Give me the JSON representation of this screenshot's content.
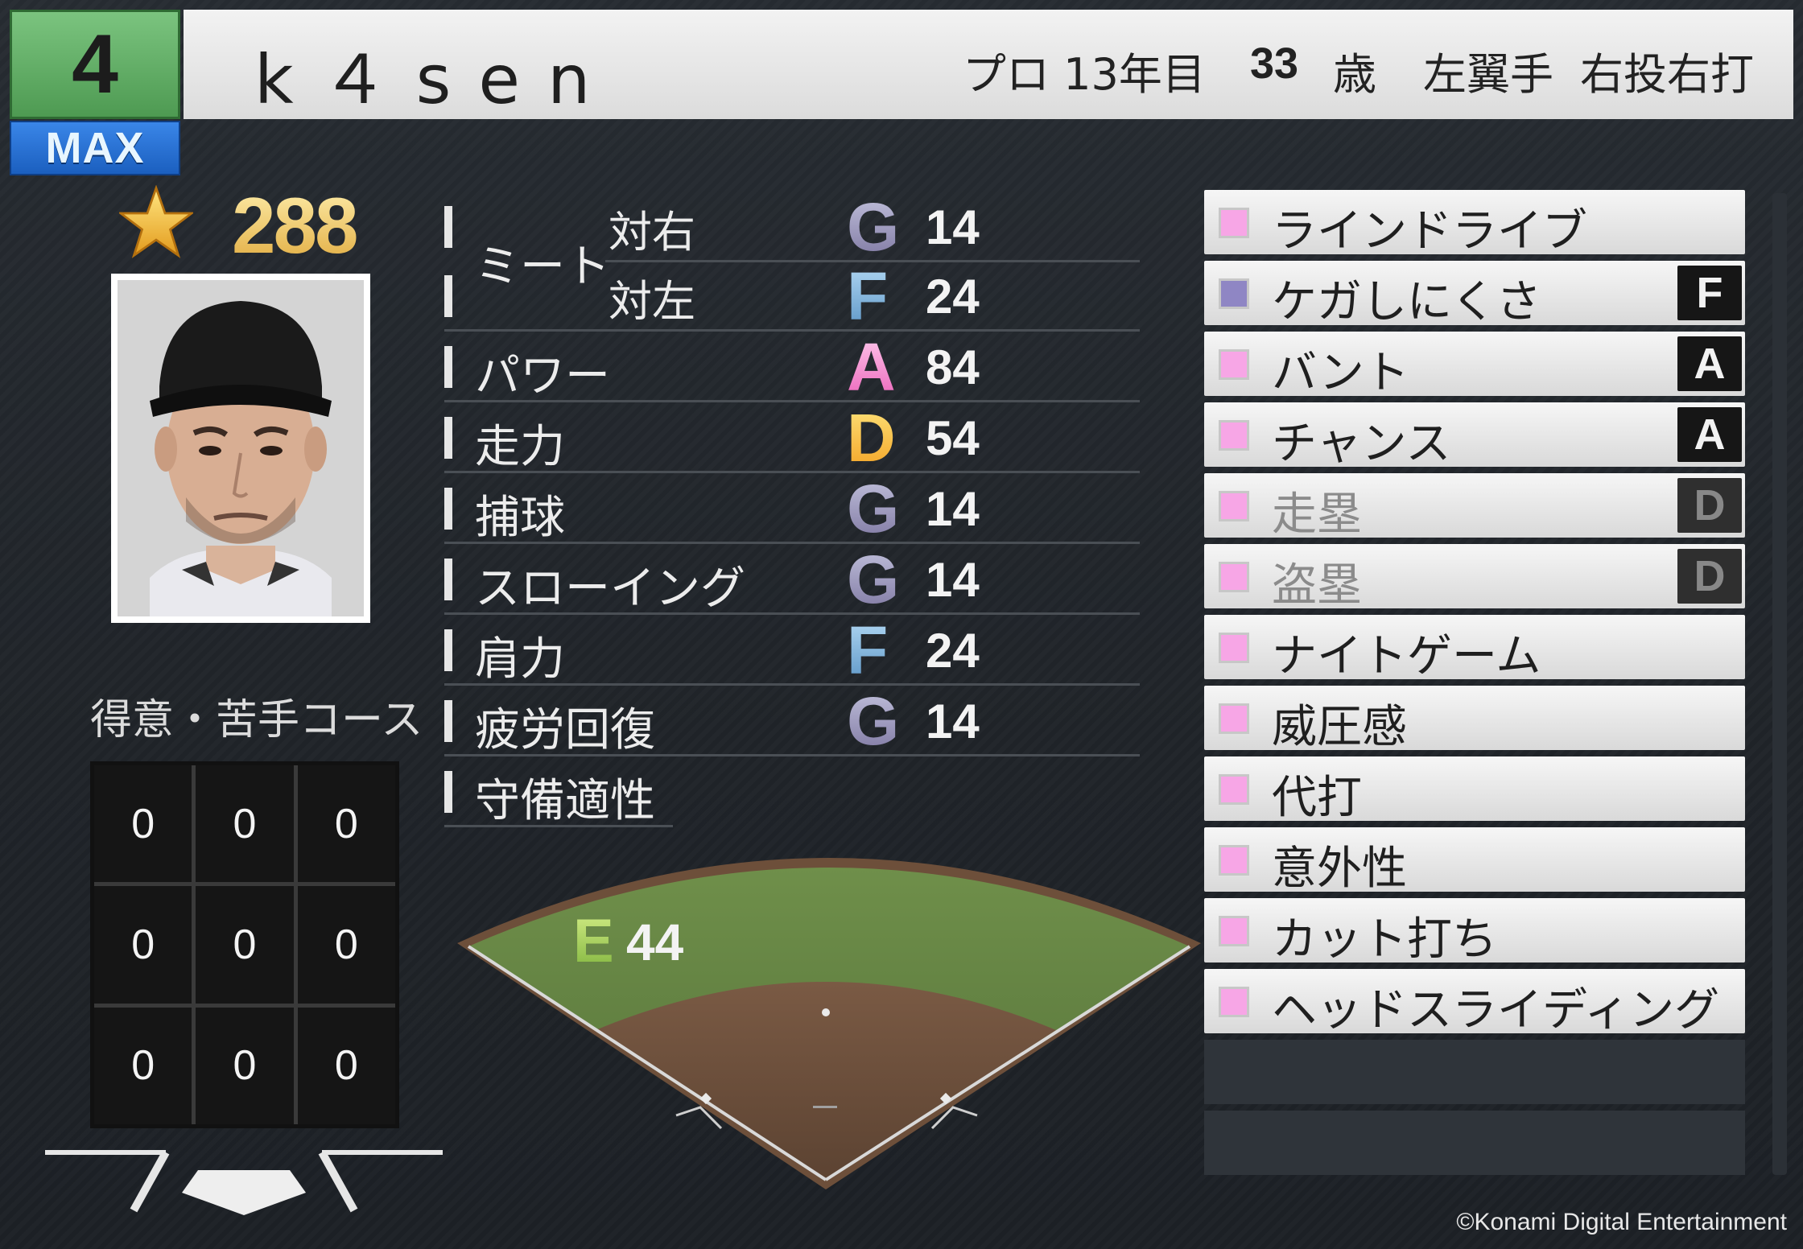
{
  "header": {
    "number": "4",
    "max_label": "MAX",
    "name": "k４sen",
    "pro_years": "プロ 13年目",
    "age": "33",
    "age_unit": "歳",
    "position": "左翼手",
    "handedness": "右投右打"
  },
  "overall": {
    "star_icon": "star-icon",
    "value": "288"
  },
  "course": {
    "label": "得意・苦手コース",
    "cells": [
      "0",
      "0",
      "0",
      "0",
      "0",
      "0",
      "0",
      "0",
      "0"
    ]
  },
  "stats": {
    "meet_label": "ミート",
    "meet_right": {
      "label": "対右",
      "grade": "G",
      "value": "14"
    },
    "meet_left": {
      "label": "対左",
      "grade": "F",
      "value": "24"
    },
    "power": {
      "label": "パワー",
      "grade": "A",
      "value": "84"
    },
    "speed": {
      "label": "走力",
      "grade": "D",
      "value": "54"
    },
    "catching": {
      "label": "捕球",
      "grade": "G",
      "value": "14"
    },
    "throwing": {
      "label": "スローイング",
      "grade": "G",
      "value": "14"
    },
    "arm": {
      "label": "肩力",
      "grade": "F",
      "value": "24"
    },
    "recovery": {
      "label": "疲労回復",
      "grade": "G",
      "value": "14"
    },
    "defense": {
      "label": "守備適性",
      "grade": "E",
      "value": "44"
    }
  },
  "grade_colors": {
    "G": "#8a82ad",
    "F": "#6aa3d6",
    "A": "#f06fc0",
    "D": "#f5b52c",
    "E": "#a9d45a"
  },
  "abilities": [
    {
      "name": "ラインドライブ",
      "rank": "",
      "color": "#f7a6e6"
    },
    {
      "name": "ケガしにくさ",
      "rank": "F",
      "color": "#8f86c4"
    },
    {
      "name": "バント",
      "rank": "A",
      "color": "#f7a6e6"
    },
    {
      "name": "チャンス",
      "rank": "A",
      "color": "#f7a6e6"
    },
    {
      "name": "走塁",
      "rank": "D",
      "color": "#f7a6e6"
    },
    {
      "name": "盗塁",
      "rank": "D",
      "color": "#f7a6e6"
    },
    {
      "name": "ナイトゲーム",
      "rank": "",
      "color": "#f7a6e6"
    },
    {
      "name": "威圧感",
      "rank": "",
      "color": "#f7a6e6"
    },
    {
      "name": "代打",
      "rank": "",
      "color": "#f7a6e6"
    },
    {
      "name": "意外性",
      "rank": "",
      "color": "#f7a6e6"
    },
    {
      "name": "カット打ち",
      "rank": "",
      "color": "#f7a6e6"
    },
    {
      "name": "ヘッドスライディング",
      "rank": "",
      "color": "#f7a6e6"
    }
  ],
  "copyright": "©Konami Digital Entertainment"
}
